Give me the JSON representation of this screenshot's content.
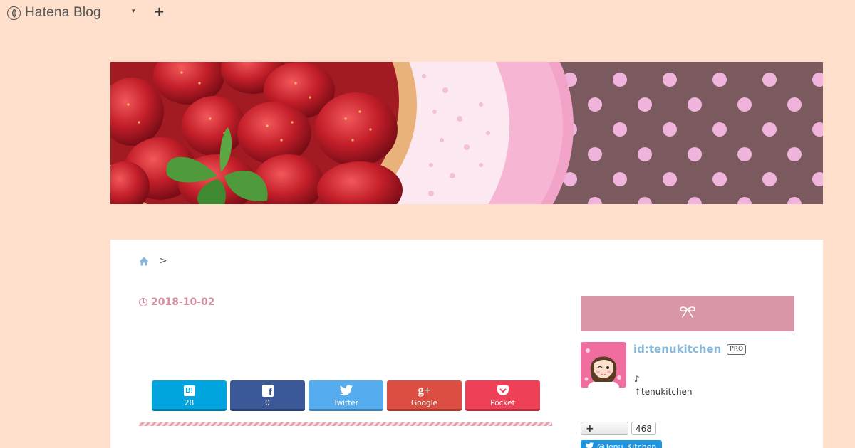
{
  "topbar": {
    "brand": "Hatena Blog",
    "menu_caret": "▾",
    "add_label": "+"
  },
  "breadcrumb": {
    "home_icon": "home-icon",
    "separator": ">"
  },
  "post": {
    "date": "2018-10-02"
  },
  "share": [
    {
      "service": "hatena-bookmark",
      "icon": "B!",
      "label": "28",
      "color": "#00a4de"
    },
    {
      "service": "facebook",
      "icon": "f",
      "label": "0",
      "color": "#3b5998"
    },
    {
      "service": "twitter",
      "icon": "twitter-bird-icon",
      "label": "Twitter",
      "color": "#55acee"
    },
    {
      "service": "google-plus",
      "icon": "g+",
      "label": "Google",
      "color": "#dc4e41"
    },
    {
      "service": "pocket",
      "icon": "pocket-icon",
      "label": "Pocket",
      "color": "#ee4056"
    }
  ],
  "sidebar": {
    "heading_icon": "ribbon-icon",
    "heading_color": "#d896a6",
    "profile": {
      "id": "id:tenukitchen",
      "badge": "PRO",
      "bio_line1": "♪",
      "bio_line2": "↑tenukitchen"
    },
    "subscribe": {
      "button": "+",
      "count": "468"
    },
    "twitter_follow": "@Tenu_Kitchen"
  },
  "colors": {
    "background": "#fddfcb",
    "accent_pink": "#d48f9f",
    "link_blue": "#86b7da"
  }
}
